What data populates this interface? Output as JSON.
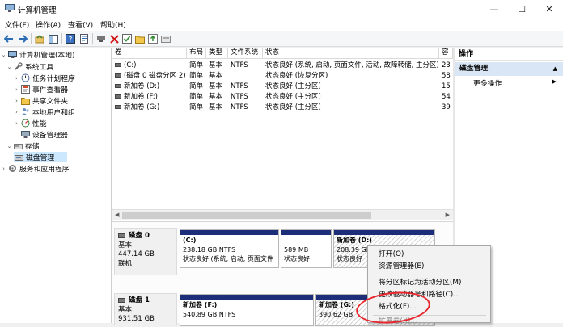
{
  "window": {
    "title": "计算机管理",
    "controls": {
      "minimize": "—",
      "maximize": "☐",
      "close": "✕"
    }
  },
  "menu": [
    "文件(F)",
    "操作(A)",
    "查看(V)",
    "帮助(H)"
  ],
  "toolbar_icons": [
    "back-icon",
    "forward-icon",
    "up-icon",
    "show-hide-tree-icon",
    "help-icon",
    "properties-icon",
    "connect-icon",
    "delete-icon",
    "check-icon",
    "folder-icon",
    "arrow-icon",
    "disk-icon"
  ],
  "tree": {
    "root": "计算机管理(本地)",
    "system_tools": "系统工具",
    "task_scheduler": "任务计划程序",
    "event_viewer": "事件查看器",
    "shared_folders": "共享文件夹",
    "local_users": "本地用户和组",
    "performance": "性能",
    "device_manager": "设备管理器",
    "storage": "存储",
    "disk_management": "磁盘管理",
    "services_apps": "服务和应用程序"
  },
  "volume_table": {
    "headers": [
      "卷",
      "布局",
      "类型",
      "文件系统",
      "状态",
      "容"
    ],
    "rows": [
      {
        "vol": "(C:)",
        "layout": "简单",
        "type": "基本",
        "fs": "NTFS",
        "status": "状态良好 (系统, 启动, 页面文件, 活动, 故障转储, 主分区)",
        "cap": "23"
      },
      {
        "vol": "(磁盘 0 磁盘分区 2)",
        "layout": "简单",
        "type": "基本",
        "fs": "",
        "status": "状态良好 (恢复分区)",
        "cap": "58"
      },
      {
        "vol": "新加卷 (D:)",
        "layout": "简单",
        "type": "基本",
        "fs": "NTFS",
        "status": "状态良好 (主分区)",
        "cap": "15"
      },
      {
        "vol": "新加卷 (F:)",
        "layout": "简单",
        "type": "基本",
        "fs": "NTFS",
        "status": "状态良好 (主分区)",
        "cap": "54"
      },
      {
        "vol": "新加卷 (G:)",
        "layout": "简单",
        "type": "基本",
        "fs": "NTFS",
        "status": "状态良好 (主分区)",
        "cap": "39"
      }
    ]
  },
  "disks": [
    {
      "name": "磁盘 0",
      "kind": "基本",
      "size": "447.14 GB",
      "state": "联机",
      "partitions": [
        {
          "title": "(C:)",
          "size": "238.18 GB NTFS",
          "status": "状态良好 (系统, 启动, 页面文件"
        },
        {
          "title": "",
          "size": "589 MB",
          "status": "状态良好"
        },
        {
          "title": "新加卷 (D:)",
          "size": "208.39 GB",
          "status": "状态良好"
        }
      ]
    },
    {
      "name": "磁盘 1",
      "kind": "基本",
      "size": "931.51 GB",
      "state": "",
      "partitions": [
        {
          "title": "新加卷 (F:)",
          "size": "540.89 GB NTFS",
          "status": ""
        },
        {
          "title": "新加卷 (G:)",
          "size": "390.62 GB",
          "status": ""
        }
      ]
    }
  ],
  "actions": {
    "header": "操作",
    "section": "磁盘管理",
    "more": "更多操作"
  },
  "context_menu": {
    "items": [
      "打开(O)",
      "资源管理器(E)",
      "将分区标记为活动分区(M)",
      "更改驱动器号和路径(C)...",
      "格式化(F)...",
      "扩展卷(X)..."
    ],
    "highlighted": "格式化(F)..."
  },
  "colors": {
    "partition_bar": "#1c2e7a",
    "highlight_ring": "#e8262d",
    "selected": "#cce8ff"
  }
}
